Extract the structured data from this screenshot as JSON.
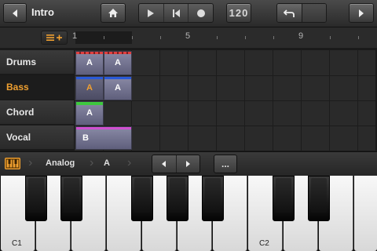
{
  "top_bar": {
    "title": "Intro",
    "tempo": "120",
    "icons": {
      "back": "chevron-left-icon",
      "home": "home-icon",
      "play": "play-icon",
      "rewind": "skip-to-start-icon",
      "record": "record-icon",
      "undo": "undo-icon",
      "redo": "redo-icon",
      "forward": "chevron-right-icon"
    }
  },
  "ruler": {
    "markers": [
      "1",
      "5",
      "9"
    ],
    "add_track_icon": "menu-add-icon"
  },
  "tracks": [
    {
      "name": "Drums",
      "selected": false
    },
    {
      "name": "Bass",
      "selected": true
    },
    {
      "name": "Chord",
      "selected": false
    },
    {
      "name": "Vocal",
      "selected": false
    }
  ],
  "clips": {
    "drums_1": "A",
    "drums_2": "A",
    "bass_1": "A",
    "bass_2": "A",
    "chord_1": "A",
    "vocal_1": "B"
  },
  "clip_colors": {
    "drums": "#e04040",
    "bass": "#2a5ad8",
    "chord": "#3ec83e",
    "vocal": "#d050d0"
  },
  "instrument_bar": {
    "instrument": "Analog",
    "pattern": "A",
    "more_label": "...",
    "keyboard_icon": "piano-icon"
  },
  "keyboard": {
    "labels": {
      "c1": "C1",
      "c2": "C2"
    }
  },
  "colors": {
    "accent": "#f0a030",
    "background": "#2a2a2a"
  }
}
